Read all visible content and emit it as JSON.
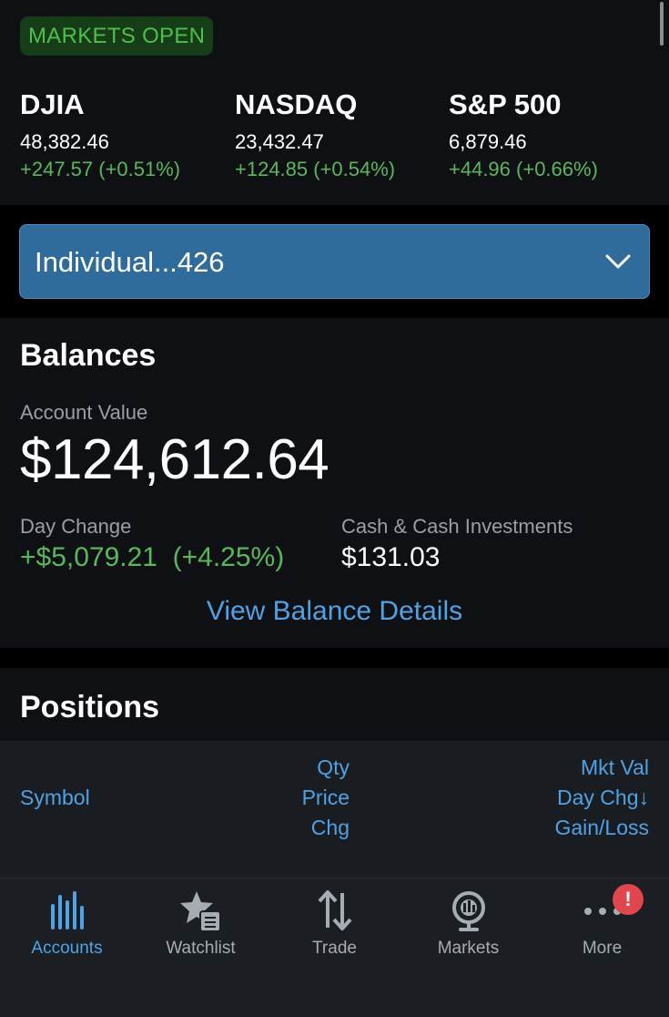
{
  "market": {
    "status": "MARKETS OPEN",
    "indices": [
      {
        "name": "DJIA",
        "value": "48,382.46",
        "change": "+247.57 (+0.51%)"
      },
      {
        "name": "NASDAQ",
        "value": "23,432.47",
        "change": "+124.85 (+0.54%)"
      },
      {
        "name": "S&P 500",
        "value": "6,879.46",
        "change": "+44.96 (+0.66%)"
      }
    ]
  },
  "account_selector": {
    "label": "Individual...426",
    "icon": "chevron-down-icon"
  },
  "balances": {
    "title": "Balances",
    "account_value_label": "Account Value",
    "account_value": "$124,612.64",
    "day_change_label": "Day Change",
    "day_change": "+$5,079.21  (+4.25%)",
    "cash_label": "Cash & Cash Investments",
    "cash_value": "$131.03",
    "details_link": "View Balance Details"
  },
  "positions": {
    "title": "Positions",
    "columns": {
      "symbol": "Symbol",
      "qty": "Qty",
      "price": "Price",
      "chg": "Chg",
      "mkt_val": "Mkt Val",
      "day_chg": "Day Chg↓",
      "gain_loss": "Gain/Loss"
    }
  },
  "tabbar": {
    "tabs": [
      {
        "label": "Accounts",
        "icon": "bar-chart-icon",
        "active": true
      },
      {
        "label": "Watchlist",
        "icon": "star-list-icon",
        "active": false
      },
      {
        "label": "Trade",
        "icon": "up-down-arrows-icon",
        "active": false
      },
      {
        "label": "Markets",
        "icon": "globe-icon",
        "active": false
      },
      {
        "label": "More",
        "icon": "more-dots-icon",
        "active": false
      }
    ],
    "notification_badge": "!"
  },
  "colors": {
    "accent_blue": "#4fa2e4",
    "positive_green": "#58b85a",
    "account_selector_bg": "#2f6c9c",
    "badge_red": "#e0474c"
  }
}
